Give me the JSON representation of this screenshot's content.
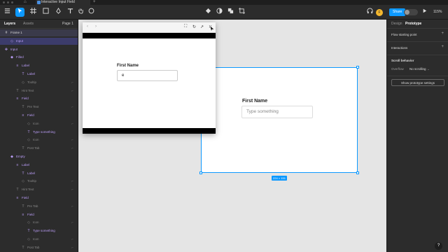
{
  "browser": {
    "tab_title": "Interactive Input Field",
    "new_tab_symbol": "+",
    "home_symbol": "⌂"
  },
  "toolbar": {
    "user_initial": "F",
    "share_label": "Share",
    "code_label": "</>",
    "zoom_label": "115%"
  },
  "left_panel": {
    "tab_layers": "Layers",
    "tab_assets": "Assets",
    "page_label": "Page 1",
    "layers": [
      {
        "name": "Frame 1",
        "indent": 0,
        "glyph": "#",
        "style": "frame"
      },
      {
        "name": "Input",
        "indent": 1,
        "glyph": "◇",
        "style": "sel-purple"
      },
      {
        "name": "Input",
        "indent": 0,
        "glyph": "✥",
        "style": "purple"
      },
      {
        "name": "Filled",
        "indent": 1,
        "glyph": "◆",
        "style": "purple"
      },
      {
        "name": "Label",
        "indent": 2,
        "glyph": "≡",
        "style": "purple"
      },
      {
        "name": "Label",
        "indent": 3,
        "glyph": "T",
        "style": "purple"
      },
      {
        "name": "Tooltip",
        "indent": 3,
        "glyph": "◇",
        "style": "gray"
      },
      {
        "name": "Hint Text",
        "indent": 2,
        "glyph": "T",
        "style": "gray"
      },
      {
        "name": "Field",
        "indent": 2,
        "glyph": "≡",
        "style": "purple"
      },
      {
        "name": "Pre Text",
        "indent": 3,
        "glyph": "T",
        "style": "gray"
      },
      {
        "name": "Field",
        "indent": 3,
        "glyph": "≡",
        "style": "purple"
      },
      {
        "name": "Icon",
        "indent": 4,
        "glyph": "◇",
        "style": "gray"
      },
      {
        "name": "Type something",
        "indent": 4,
        "glyph": "T",
        "style": "purple"
      },
      {
        "name": "Icon",
        "indent": 4,
        "glyph": "◇",
        "style": "gray"
      },
      {
        "name": "Post Tab",
        "indent": 3,
        "glyph": "T",
        "style": "gray"
      },
      {
        "name": "Empty",
        "indent": 1,
        "glyph": "◆",
        "style": "purple"
      },
      {
        "name": "Label",
        "indent": 2,
        "glyph": "≡",
        "style": "purple"
      },
      {
        "name": "Label",
        "indent": 3,
        "glyph": "T",
        "style": "purple"
      },
      {
        "name": "Tooltip",
        "indent": 3,
        "glyph": "◇",
        "style": "gray"
      },
      {
        "name": "Hint Text",
        "indent": 2,
        "glyph": "T",
        "style": "gray"
      },
      {
        "name": "Field",
        "indent": 2,
        "glyph": "≡",
        "style": "purple"
      },
      {
        "name": "Pre Tab",
        "indent": 3,
        "glyph": "T",
        "style": "gray"
      },
      {
        "name": "Field",
        "indent": 3,
        "glyph": "≡",
        "style": "purple"
      },
      {
        "name": "Icon",
        "indent": 4,
        "glyph": "◇",
        "style": "gray"
      },
      {
        "name": "Type something",
        "indent": 4,
        "glyph": "T",
        "style": "purple"
      },
      {
        "name": "Icon",
        "indent": 4,
        "glyph": "◇",
        "style": "gray"
      },
      {
        "name": "Post Tab",
        "indent": 3,
        "glyph": "T",
        "style": "gray"
      }
    ]
  },
  "right_panel": {
    "tab_design": "Design",
    "tab_prototype": "Prototype",
    "flow_label": "Flow starting point",
    "interactions_label": "Interactions",
    "scroll_label": "Scroll behavior",
    "overflow_label": "Overflow",
    "overflow_value": "No scrolling",
    "prototype_settings_label": "Show prototype settings",
    "help_symbol": "?"
  },
  "canvas": {
    "label": "First Name",
    "placeholder": "Type something",
    "dimensions": "224 × 151"
  },
  "preview": {
    "label": "First Name",
    "value": "e"
  },
  "colors": {
    "accent": "#0d99ff",
    "panel": "#2c2c2c",
    "canvas_bg": "#e5e5e5",
    "component_purple": "#b99cf5"
  }
}
